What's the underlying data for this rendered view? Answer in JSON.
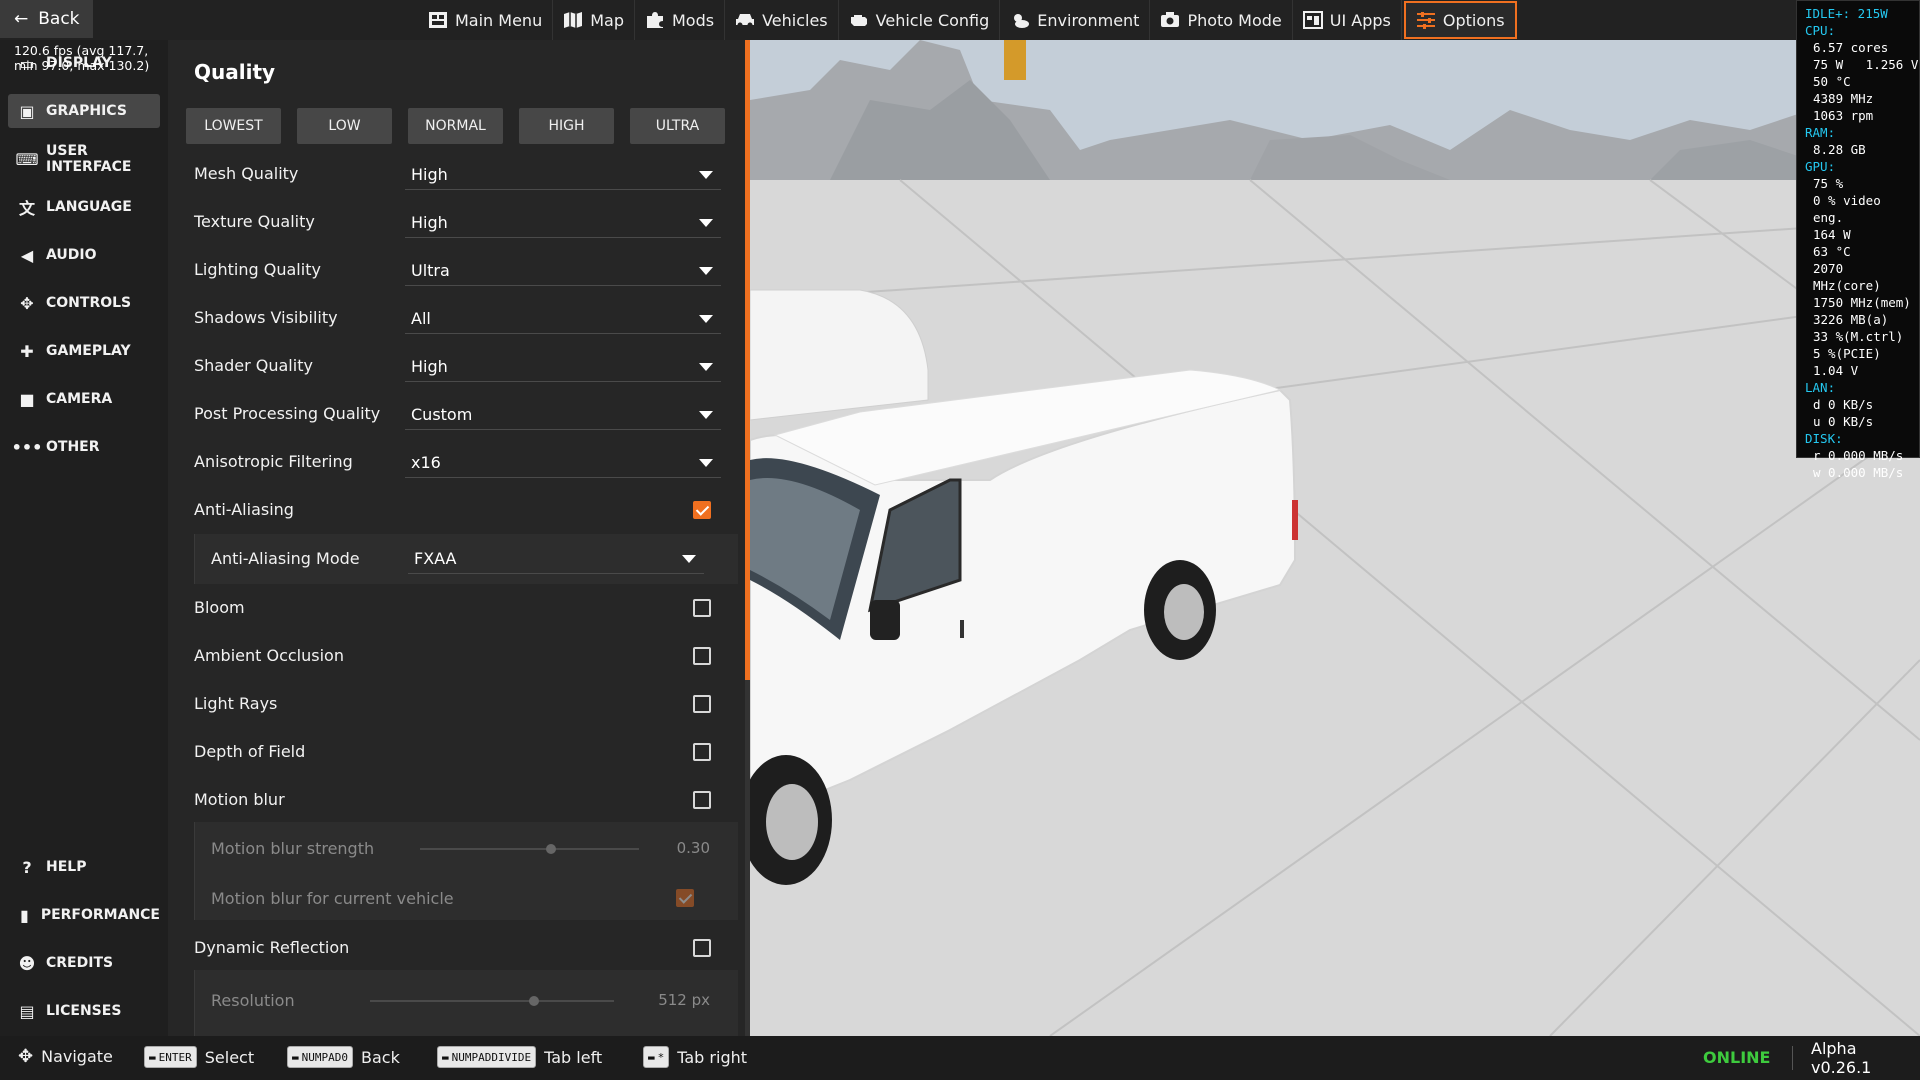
{
  "topbar": {
    "back_label": "Back",
    "menu": [
      {
        "label": "Main Menu",
        "icon": "main-menu-icon"
      },
      {
        "label": "Map",
        "icon": "map-icon"
      },
      {
        "label": "Mods",
        "icon": "puzzle-icon"
      },
      {
        "label": "Vehicles",
        "icon": "car-icon"
      },
      {
        "label": "Vehicle Config",
        "icon": "engine-icon"
      },
      {
        "label": "Environment",
        "icon": "weather-icon"
      },
      {
        "label": "Photo Mode",
        "icon": "camera-icon"
      },
      {
        "label": "UI Apps",
        "icon": "apps-icon"
      },
      {
        "label": "Options",
        "icon": "sliders-icon",
        "active": true
      }
    ]
  },
  "fps_text": "120.6 fps (avg 117.7, min 97.0, max 130.2)",
  "perf": {
    "idle": "IDLE+: 215W",
    "cpu_head": "CPU:",
    "cpu": [
      "6.57 cores",
      "75 W   1.256 V",
      "50 °C",
      "4389 MHz",
      "1063 rpm"
    ],
    "ram_head": "RAM:",
    "ram": [
      "8.28 GB"
    ],
    "gpu_head": "GPU:",
    "gpu": [
      "75 %",
      "0 % video eng.",
      "164 W",
      "63 °C",
      "2070 MHz(core)",
      "1750 MHz(mem)",
      "3226 MB(a)",
      "33 %(M.ctrl)",
      "5 %(PCIE)",
      "1.04 V"
    ],
    "lan_head": "LAN:",
    "lan": [
      "d 0 KB/s",
      "u 0 KB/s"
    ],
    "disk_head": "DISK:",
    "disk": [
      "r 0.000 MB/s",
      "w 0.000 MB/s"
    ]
  },
  "leftnav": {
    "items": [
      {
        "label": "DISPLAY",
        "icon": "display-icon"
      },
      {
        "label": "GRAPHICS",
        "icon": "image-icon",
        "selected": true
      },
      {
        "label": "USER INTERFACE",
        "icon": "keyboard-icon"
      },
      {
        "label": "LANGUAGE",
        "icon": "translate-icon"
      },
      {
        "label": "AUDIO",
        "icon": "speaker-icon"
      },
      {
        "label": "CONTROLS",
        "icon": "gamepad-icon"
      },
      {
        "label": "GAMEPLAY",
        "icon": "puzzle-icon"
      },
      {
        "label": "CAMERA",
        "icon": "video-camera-icon"
      },
      {
        "label": "OTHER",
        "icon": "more-icon"
      }
    ],
    "bottom_items": [
      {
        "label": "HELP",
        "icon": "help-icon"
      },
      {
        "label": "PERFORMANCE",
        "icon": "bar-chart-icon"
      },
      {
        "label": "CREDITS",
        "icon": "people-icon"
      },
      {
        "label": "LICENSES",
        "icon": "clipboard-icon"
      }
    ]
  },
  "panel": {
    "title": "Quality",
    "presets": [
      "LOWEST",
      "LOW",
      "NORMAL",
      "HIGH",
      "ULTRA"
    ],
    "dropdowns": [
      {
        "label": "Mesh Quality",
        "value": "High"
      },
      {
        "label": "Texture Quality",
        "value": "High"
      },
      {
        "label": "Lighting Quality",
        "value": "Ultra"
      },
      {
        "label": "Shadows Visibility",
        "value": "All"
      },
      {
        "label": "Shader Quality",
        "value": "High"
      },
      {
        "label": "Post Processing Quality",
        "value": "Custom"
      },
      {
        "label": "Anisotropic Filtering",
        "value": "x16"
      }
    ],
    "anti_aliasing": {
      "label": "Anti-Aliasing",
      "checked": true
    },
    "aa_mode": {
      "label": "Anti-Aliasing Mode",
      "value": "FXAA"
    },
    "checkboxes": [
      {
        "label": "Bloom",
        "checked": false
      },
      {
        "label": "Ambient Occlusion",
        "checked": false
      },
      {
        "label": "Light Rays",
        "checked": false
      },
      {
        "label": "Depth of Field",
        "checked": false
      },
      {
        "label": "Motion blur",
        "checked": false
      }
    ],
    "motion_blur_strength": {
      "label": "Motion blur strength",
      "value": 0.3,
      "display": "0.30"
    },
    "motion_blur_vehicle": {
      "label": "Motion blur for current vehicle",
      "checked": true
    },
    "dynamic_reflection": {
      "label": "Dynamic Reflection",
      "checked": false
    },
    "resolution": {
      "label": "Resolution",
      "display": "512 px",
      "fraction": 0.66
    }
  },
  "bottombar": {
    "hints": [
      {
        "key": "",
        "key_icon": "dpad-icon",
        "label": "Navigate"
      },
      {
        "key": "ENTER",
        "key_icon": "keyboard-icon",
        "label": "Select"
      },
      {
        "key": "NUMPAD0",
        "key_icon": "keyboard-icon",
        "label": "Back"
      },
      {
        "key": "NUMPADDIVIDE",
        "key_icon": "keyboard-icon",
        "label": "Tab left"
      },
      {
        "key": "*",
        "key_icon": "keyboard-icon",
        "label": "Tab right"
      }
    ],
    "status": "ONLINE",
    "version": "Alpha v0.26.1"
  },
  "colors": {
    "accent": "#f07020",
    "online": "#3ecb3e",
    "perf_head": "#24c8f0"
  }
}
